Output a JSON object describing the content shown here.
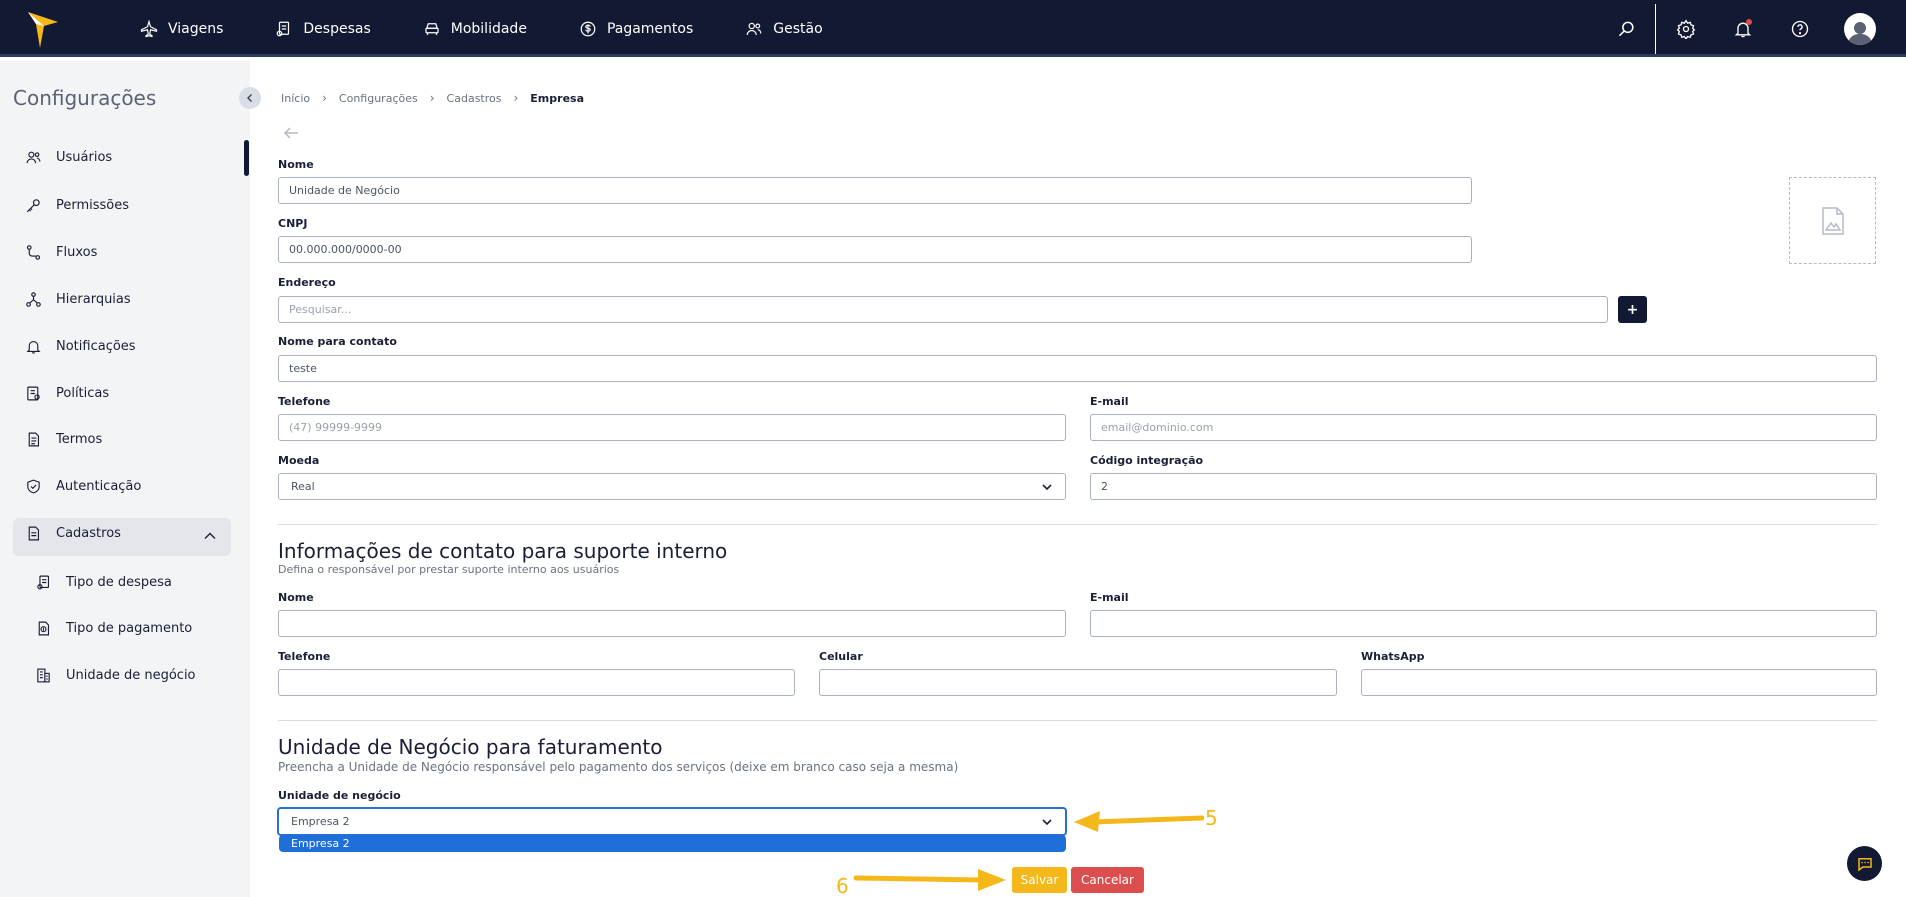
{
  "colors": {
    "nav_bg": "#121a33",
    "accent": "#f5b81a",
    "danger": "#dc4d4d",
    "select_blue": "#1e6fd9"
  },
  "nav": {
    "items": [
      {
        "label": "Viagens",
        "icon": "plane-icon"
      },
      {
        "label": "Despesas",
        "icon": "receipt-icon"
      },
      {
        "label": "Mobilidade",
        "icon": "car-icon"
      },
      {
        "label": "Pagamentos",
        "icon": "dollar-icon"
      },
      {
        "label": "Gestão",
        "icon": "users-icon"
      }
    ],
    "right_icons": [
      "search-icon",
      "gear-icon",
      "bell-icon",
      "help-icon",
      "avatar-icon"
    ]
  },
  "sidebar": {
    "title": "Configurações",
    "items": [
      {
        "label": "Usuários",
        "icon": "users-icon"
      },
      {
        "label": "Permissões",
        "icon": "key-icon"
      },
      {
        "label": "Fluxos",
        "icon": "flow-icon"
      },
      {
        "label": "Hierarquias",
        "icon": "hierarchy-icon"
      },
      {
        "label": "Notificações",
        "icon": "bell-icon"
      },
      {
        "label": "Políticas",
        "icon": "policy-icon"
      },
      {
        "label": "Termos",
        "icon": "document-icon"
      },
      {
        "label": "Autenticação",
        "icon": "shield-icon"
      }
    ],
    "group": {
      "label": "Cadastros",
      "icon": "file-icon"
    },
    "subitems": [
      {
        "label": "Tipo de despesa",
        "icon": "receipt-icon"
      },
      {
        "label": "Tipo de pagamento",
        "icon": "payment-doc-icon"
      },
      {
        "label": "Unidade de negócio",
        "icon": "building-icon"
      }
    ]
  },
  "breadcrumb": [
    "Início",
    "Configurações",
    "Cadastros",
    "Empresa"
  ],
  "form": {
    "nome": {
      "label": "Nome",
      "value": "Unidade de Negócio"
    },
    "cnpj": {
      "label": "CNPJ",
      "value": "00.000.000/0000-00"
    },
    "endereco": {
      "label": "Endereço",
      "placeholder": "Pesquisar...",
      "add_label": "+"
    },
    "contato": {
      "label": "Nome para contato",
      "value": "teste"
    },
    "telefone": {
      "label": "Telefone",
      "placeholder": "(47) 99999-9999"
    },
    "email": {
      "label": "E-mail",
      "placeholder": "email@dominio.com"
    },
    "moeda": {
      "label": "Moeda",
      "value": "Real"
    },
    "codigo": {
      "label": "Código integração",
      "value": "2"
    }
  },
  "suporte": {
    "title": "Informações de contato para suporte interno",
    "subtitle": "Defina o responsável por prestar suporte interno aos usuários",
    "nome_label": "Nome",
    "email_label": "E-mail",
    "telefone_label": "Telefone",
    "celular_label": "Celular",
    "whatsapp_label": "WhatsApp"
  },
  "faturamento": {
    "title": "Unidade de Negócio para faturamento",
    "subtitle": "Preencha a Unidade de Negócio responsável pelo pagamento dos serviços (deixe em branco caso seja a mesma)",
    "label": "Unidade de negócio",
    "value": "Empresa 2",
    "option_highlighted": "Empresa 2"
  },
  "actions": {
    "save": "Salvar",
    "cancel": "Cancelar"
  },
  "annotations": {
    "step5": "5",
    "step6": "6"
  }
}
